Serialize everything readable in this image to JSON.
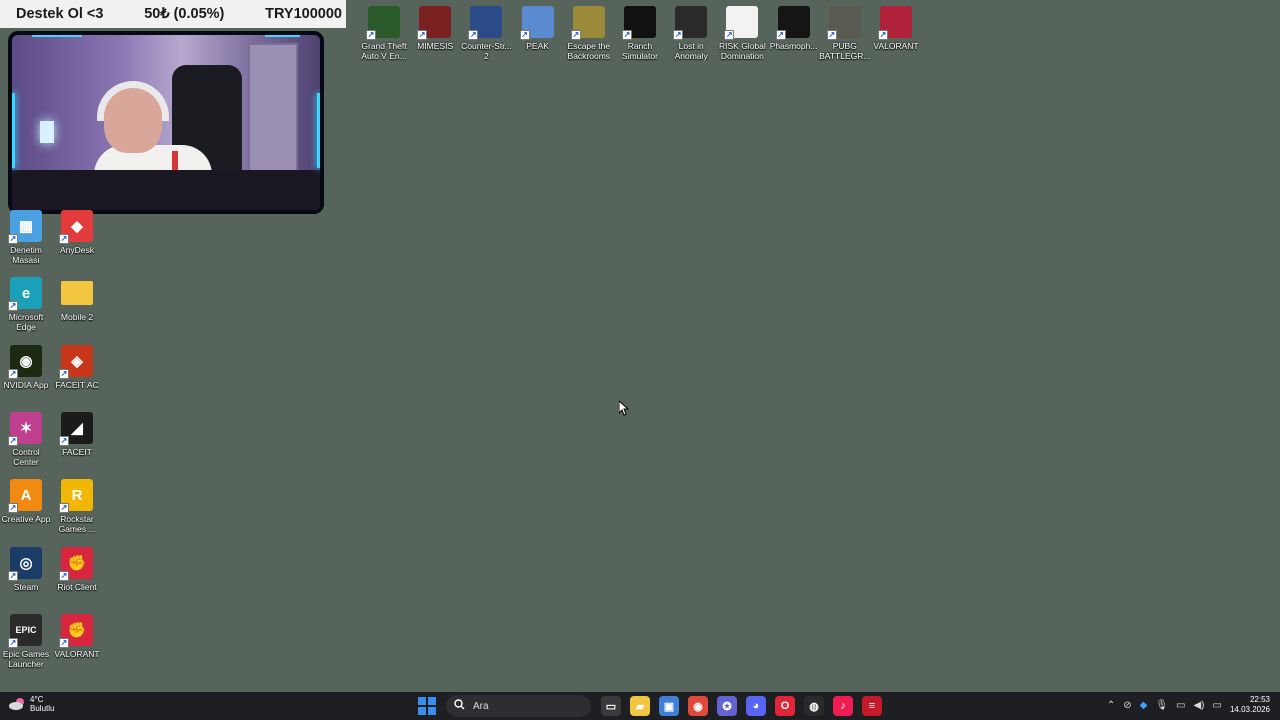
{
  "donation_bar": {
    "left": "Destek Ol <3",
    "middle": "50₺ (0.05%)",
    "right": "TRY100000"
  },
  "top_icons": [
    {
      "label": "Grand Theft\nAuto V En...",
      "icon": "gta-v-icon",
      "color": "#2a5a2a"
    },
    {
      "label": "MIMESIS",
      "icon": "mimesis-icon",
      "color": "#7a2020"
    },
    {
      "label": "Counter-Str...\n2",
      "icon": "counter-strike-icon",
      "color": "#2a4a88"
    },
    {
      "label": "PEAK",
      "icon": "peak-icon",
      "color": "#5a8ad0"
    },
    {
      "label": "Escape the\nBackrooms",
      "icon": "escape-backrooms-icon",
      "color": "#9a8a3a"
    },
    {
      "label": "Ranch\nSimulator",
      "icon": "ranch-simulator-icon",
      "color": "#111111"
    },
    {
      "label": "Lost in\nAnomaly",
      "icon": "lost-in-anomaly-icon",
      "color": "#2a2a2a"
    },
    {
      "label": "RISK Global\nDomination",
      "icon": "risk-icon",
      "color": "#f2f2f2"
    },
    {
      "label": "Phasmoph...",
      "icon": "phasmophobia-icon",
      "color": "#151515"
    },
    {
      "label": "PUBG\nBATTLEGR...",
      "icon": "pubg-icon",
      "color": "#5a5a50"
    },
    {
      "label": "VALORANT",
      "icon": "valorant-icon",
      "color": "#b0223a"
    }
  ],
  "left_icons": [
    {
      "label": "Denetim\nMasası",
      "icon": "control-panel-icon",
      "color": "#4aa0e0",
      "glyph": "▦"
    },
    {
      "label": "AnyDesk",
      "icon": "anydesk-icon",
      "color": "#e33b3b",
      "glyph": "◆"
    },
    {
      "label": "Microsoft\nEdge",
      "icon": "edge-icon",
      "color": "#1aa0b8",
      "glyph": "e"
    },
    {
      "label": "Mobile 2",
      "icon": "folder-icon",
      "color": "#f2c641",
      "glyph": ""
    },
    {
      "label": "NVIDIA App",
      "icon": "nvidia-icon",
      "color": "#1d2a12",
      "glyph": "◉"
    },
    {
      "label": "FACEIT AC",
      "icon": "faceit-ac-icon",
      "color": "#c8371a",
      "glyph": "◈"
    },
    {
      "label": "Control\nCenter",
      "icon": "control-center-icon",
      "color": "#c04090",
      "glyph": "✶"
    },
    {
      "label": "FACEIT",
      "icon": "faceit-icon",
      "color": "#1b1b1b",
      "glyph": "◢"
    },
    {
      "label": "Creative App",
      "icon": "creative-app-icon",
      "color": "#f08a10",
      "glyph": "A"
    },
    {
      "label": "Rockstar\nGames ...",
      "icon": "rockstar-icon",
      "color": "#f2b705",
      "glyph": "R"
    },
    {
      "label": "Steam",
      "icon": "steam-icon",
      "color": "#1b3c66",
      "glyph": "◎"
    },
    {
      "label": "Riot Client",
      "icon": "riot-client-icon",
      "color": "#d7263d",
      "glyph": "✊"
    },
    {
      "label": "Epic Games\nLauncher",
      "icon": "epic-games-icon",
      "color": "#2a2a2a",
      "glyph": "EPIC"
    },
    {
      "label": "VALORANT",
      "icon": "valorant-icon",
      "color": "#d7263d",
      "glyph": "✊"
    }
  ],
  "taskbar": {
    "weather_temp": "4°C",
    "weather_desc": "Bulutlu",
    "search_placeholder": "Ara",
    "apps": [
      {
        "name": "explorer-app-icon",
        "color": "#3a3a3a",
        "glyph": "▭"
      },
      {
        "name": "file-explorer-icon",
        "color": "#f2c641",
        "glyph": "▰"
      },
      {
        "name": "store-icon",
        "color": "#3f7fd8",
        "glyph": "▣"
      },
      {
        "name": "chrome-icon",
        "color": "#e14a3a",
        "glyph": "◉"
      },
      {
        "name": "teams-icon",
        "color": "#6265d1",
        "glyph": "✪"
      },
      {
        "name": "discord-icon",
        "color": "#5865f2",
        "glyph": "◕"
      },
      {
        "name": "opera-icon",
        "color": "#e0243a",
        "glyph": "O"
      },
      {
        "name": "obs-icon",
        "color": "#2a2a2a",
        "glyph": "◍"
      },
      {
        "name": "tiktok-icon",
        "color": "#ee1d52",
        "glyph": "♪"
      },
      {
        "name": "overlay-icon",
        "color": "#c41a2a",
        "glyph": "≡"
      }
    ],
    "time": "22:53",
    "date": "14.03.2026"
  }
}
